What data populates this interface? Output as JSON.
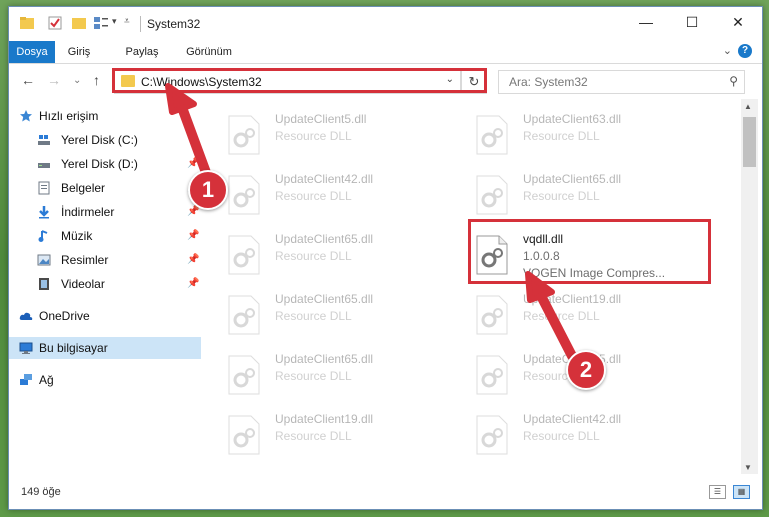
{
  "window": {
    "title": "System32",
    "minimize_symbol": "—",
    "maximize_symbol": "☐",
    "close_symbol": "✕"
  },
  "ribbon": {
    "tabs": [
      {
        "label": "Dosya",
        "active": true
      },
      {
        "label": "Giriş"
      },
      {
        "label": "Paylaş"
      },
      {
        "label": "Görünüm"
      }
    ],
    "expand_symbol": "⌄",
    "help_symbol": "?"
  },
  "navbar": {
    "back_symbol": "←",
    "forward_symbol": "→",
    "recent_symbol": "⌄",
    "up_symbol": "↑",
    "address": "C:\\Windows\\System32",
    "address_drop_symbol": "⌄",
    "refresh_symbol": "↻",
    "search_placeholder": "Ara: System32",
    "search_symbol": "⚲"
  },
  "sidebar": {
    "quick_access": "Hızlı erişim",
    "items": [
      {
        "label": "Yerel Disk (C:)",
        "icon": "drive-icon",
        "pinned": false
      },
      {
        "label": "Yerel Disk (D:)",
        "icon": "drive-icon",
        "pinned": true
      },
      {
        "label": "Belgeler",
        "icon": "documents-icon",
        "pinned": true
      },
      {
        "label": "İndirmeler",
        "icon": "downloads-icon",
        "pinned": true
      },
      {
        "label": "Müzik",
        "icon": "music-icon",
        "pinned": true
      },
      {
        "label": "Resimler",
        "icon": "pictures-icon",
        "pinned": true
      },
      {
        "label": "Videolar",
        "icon": "videos-icon",
        "pinned": true
      }
    ],
    "pin_symbol": "📌",
    "onedrive": "OneDrive",
    "this_pc": "Bu bilgisayar",
    "network": "Ağ"
  },
  "files": {
    "left_column": [
      {
        "name": "UpdateClient5.dll",
        "type": "Resource DLL"
      },
      {
        "name": "UpdateClient42.dll",
        "type": "Resource DLL"
      },
      {
        "name": "UpdateClient65.dll",
        "type": "Resource DLL"
      },
      {
        "name": "UpdateClient65.dll",
        "type": "Resource DLL"
      },
      {
        "name": "UpdateClient65.dll",
        "type": "Resource DLL"
      },
      {
        "name": "UpdateClient19.dll",
        "type": "Resource DLL"
      }
    ],
    "right_column": [
      {
        "name": "UpdateClient63.dll",
        "type": "Resource DLL"
      },
      {
        "name": "UpdateClient65.dll",
        "type": "Resource DLL"
      },
      {
        "name": "vqdll.dll",
        "type": "1.0.0.8",
        "description": "VQGEN Image Compres..."
      },
      {
        "name": "UpdateClient19.dll",
        "type": "Resource DLL"
      },
      {
        "name": "UpdateClient65.dll",
        "type": "Resource DLL"
      },
      {
        "name": "UpdateClient42.dll",
        "type": "Resource DLL"
      }
    ]
  },
  "status": {
    "item_count": "149 öğe",
    "details_view_symbol": "☰",
    "tiles_view_symbol": "▦"
  },
  "callouts": {
    "step1": "1",
    "step2": "2",
    "color": "#d5313a"
  },
  "colors": {
    "accent": "#1979ca",
    "selection": "#cce4f7",
    "highlight_red": "#d5313a"
  }
}
